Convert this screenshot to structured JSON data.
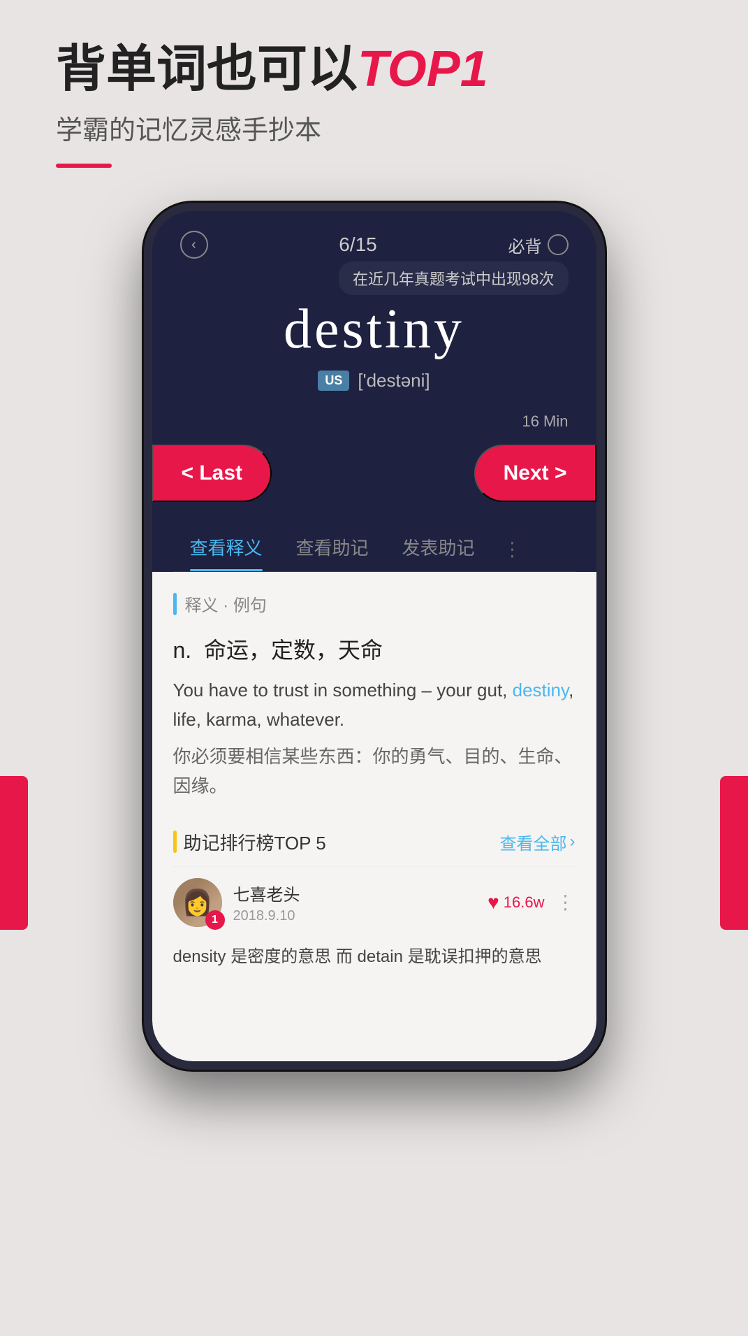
{
  "header": {
    "headline_part1": "背单词也可以",
    "headline_part2": "TOP1",
    "subtitle": "学霸的记忆灵感手抄本"
  },
  "phone": {
    "progress": "6/15",
    "must_remember": "必背",
    "tooltip": "在近几年真题考试中出现98次",
    "word": "destiny",
    "us_label": "US",
    "phonetic": "['destəni]",
    "timer": "16 Min",
    "btn_last": "< Last",
    "btn_next": "Next >",
    "tabs": [
      {
        "label": "查看释义",
        "active": true
      },
      {
        "label": "查看助记",
        "active": false
      },
      {
        "label": "发表助记",
        "active": false
      }
    ],
    "section_label": "释义 · 例句",
    "pos": "n.",
    "definition": "命运，定数，天命",
    "example_en_before": "You have to trust in something – your gut, ",
    "example_word": "destiny",
    "example_en_after": ", life, karma, whatever.",
    "example_cn": "你必须要相信某些东西：你的勇气、目的、生命、因缘。",
    "mnemonic_title": "助记排行榜TOP 5",
    "view_all": "查看全部",
    "user": {
      "name": "七喜老头",
      "date": "2018.9.10",
      "likes": "16.6w",
      "rank": "1"
    },
    "mnemonic_content": "density 是密度的意思 而 detain 是耽误扣押的意思"
  }
}
